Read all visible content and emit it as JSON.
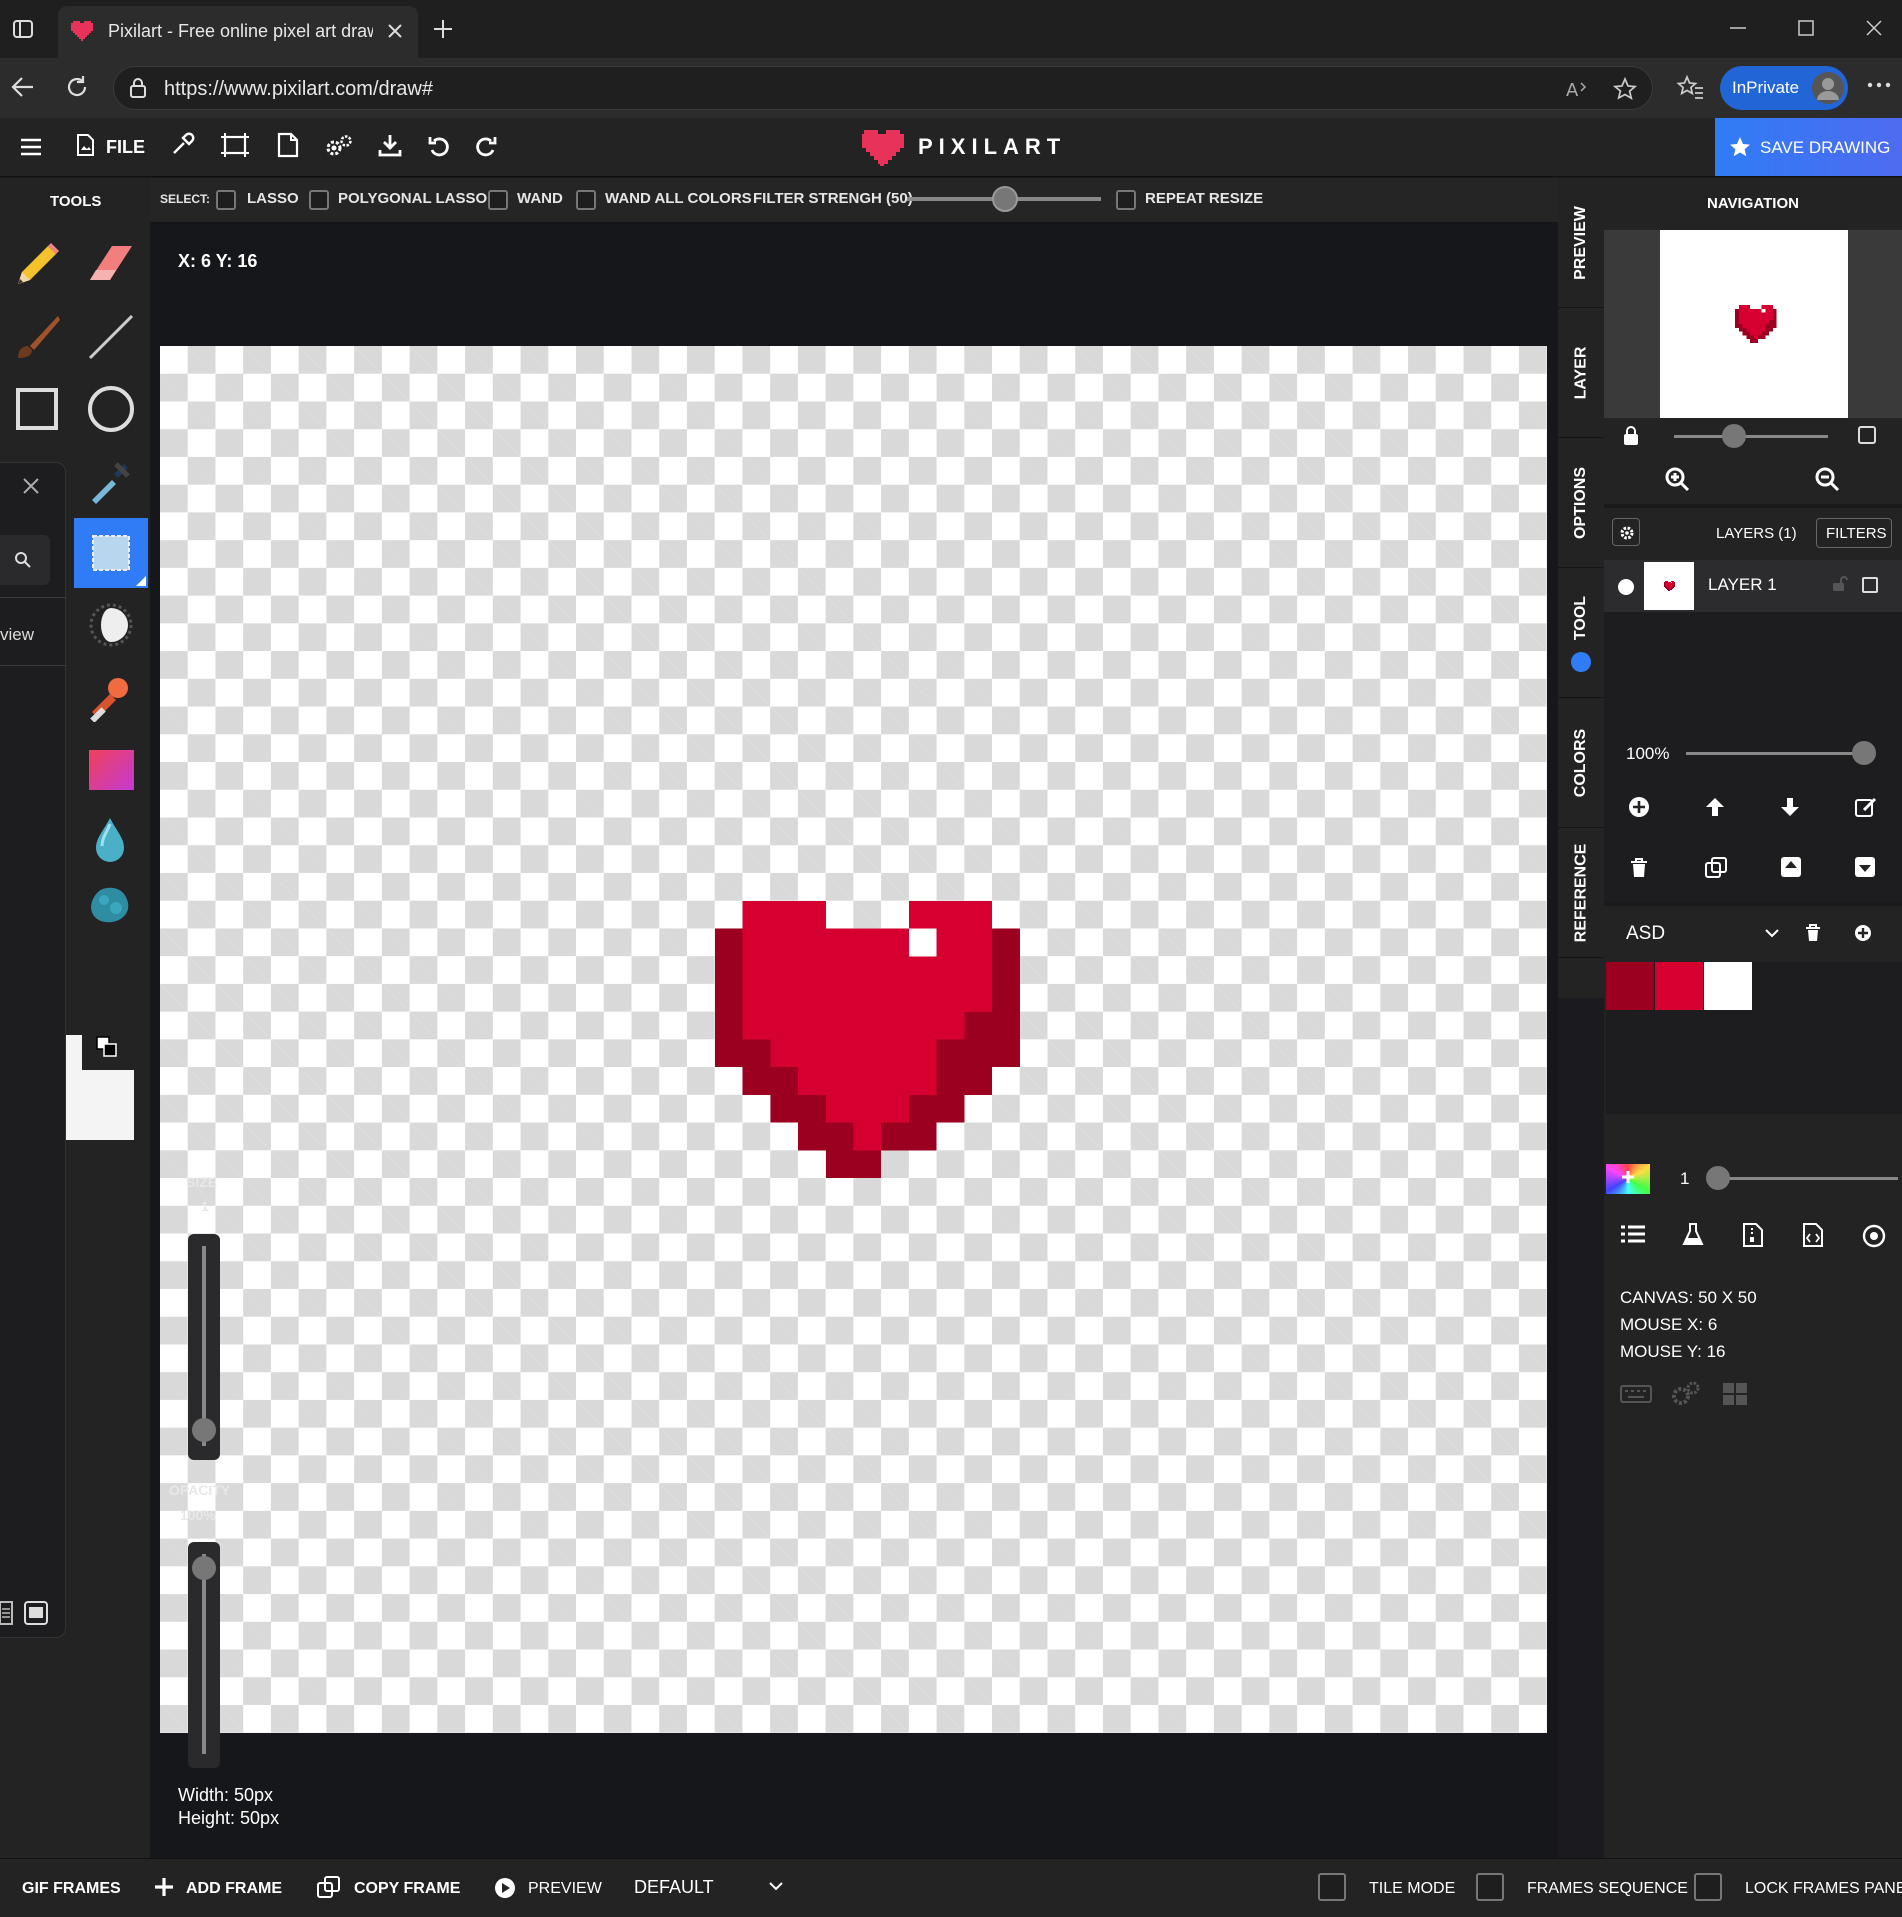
{
  "browser": {
    "tab_title": "Pixilart - Free online pixel art draw",
    "url": "https://www.pixilart.com/draw#",
    "profile_label": "InPrivate"
  },
  "app": {
    "brand": "PIXILART",
    "file_label": "FILE",
    "save_label": "SAVE DRAWING",
    "accent_color": "#2f7cf6"
  },
  "left": {
    "tools_label": "TOOLS",
    "size_label": "SIZE",
    "size_value": "1",
    "opacity_label": "OPACITY",
    "opacity_value": "100%",
    "view_text": "view"
  },
  "selectbar": {
    "select_label": "SELECT:",
    "lasso": "LASSO",
    "polygonal_lasso": "POLYGONAL LASSO",
    "wand": "WAND",
    "wand_all_colors": "WAND ALL COLORS",
    "filter_strength": "FILTER STRENGH (50)",
    "filter_strength_value": 50,
    "repeat_resize": "REPEAT RESIZE"
  },
  "canvas": {
    "coords": "X: 6 Y: 16",
    "width_text": "Width: 50px",
    "height_text": "Height: 50px",
    "pixel_colors": {
      "dark": "#9b0021",
      "main": "#d5002f",
      "white": "#ffffff"
    }
  },
  "vtabs": {
    "preview": "PREVIEW",
    "layer": "LAYER",
    "options": "OPTIONS",
    "tool": "TOOL",
    "colors": "COLORS",
    "reference": "REFERENCE"
  },
  "right": {
    "navigation": "NAVIGATION",
    "layers_label": "LAYERS (1)",
    "filters_label": "FILTERS",
    "layer_name": "LAYER 1",
    "layer_opacity": "100%",
    "palette_name": "ASD",
    "palette_colors": [
      "#9b0021",
      "#d5002f",
      "#ffffff"
    ],
    "brush_size": "1",
    "canvas_info": "CANVAS: 50 X 50",
    "mouse_x": "MOUSE X: 6",
    "mouse_y": "MOUSE Y: 16"
  },
  "bottom": {
    "gif_frames": "GIF FRAMES",
    "add_frame": "ADD FRAME",
    "copy_frame": "COPY FRAME",
    "preview": "PREVIEW",
    "mode": "DEFAULT",
    "tile_mode": "TILE MODE",
    "frames_sequence": "FRAMES SEQUENCE",
    "lock_frames_panel": "LOCK FRAMES PANEL"
  }
}
